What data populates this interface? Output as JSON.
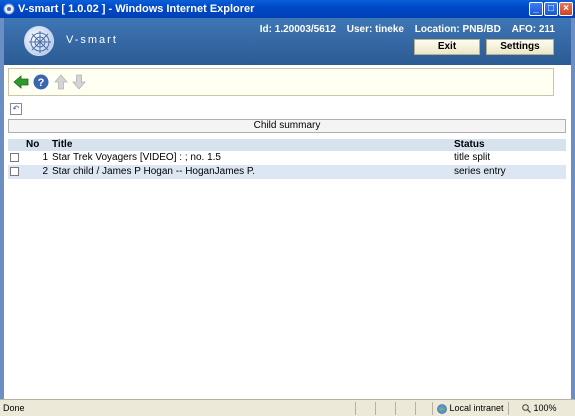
{
  "window": {
    "title": "V-smart [ 1.0.02 ] - Windows Internet Explorer"
  },
  "header": {
    "logo_text": "V-smart",
    "id_label": "Id: 1.20003/5612",
    "user_label": "User: tineke",
    "location_label": "Location: PNB/BD",
    "afo_label": "AFO: 211",
    "exit_label": "Exit",
    "settings_label": "Settings"
  },
  "toolbar": {
    "icons": [
      "back-arrow-icon",
      "help-icon",
      "up-arrow-icon",
      "down-arrow-icon"
    ]
  },
  "section": {
    "title": "Child summary"
  },
  "table": {
    "columns": [
      "No",
      "Title",
      "Status"
    ],
    "rows": [
      {
        "no": "1",
        "title": "Star Trek Voyagers [VIDEO] : ; no. 1.5",
        "status": "title split"
      },
      {
        "no": "2",
        "title": "Star child / James P Hogan -- HoganJames P.",
        "status": "series entry"
      }
    ]
  },
  "statusbar": {
    "left": "Done",
    "zone": "Local intranet",
    "zoom": "100%"
  },
  "colors": {
    "header_blue": "#2c5b94",
    "row_alt": "#dde7f3",
    "accent_green": "#2e9a2e"
  }
}
